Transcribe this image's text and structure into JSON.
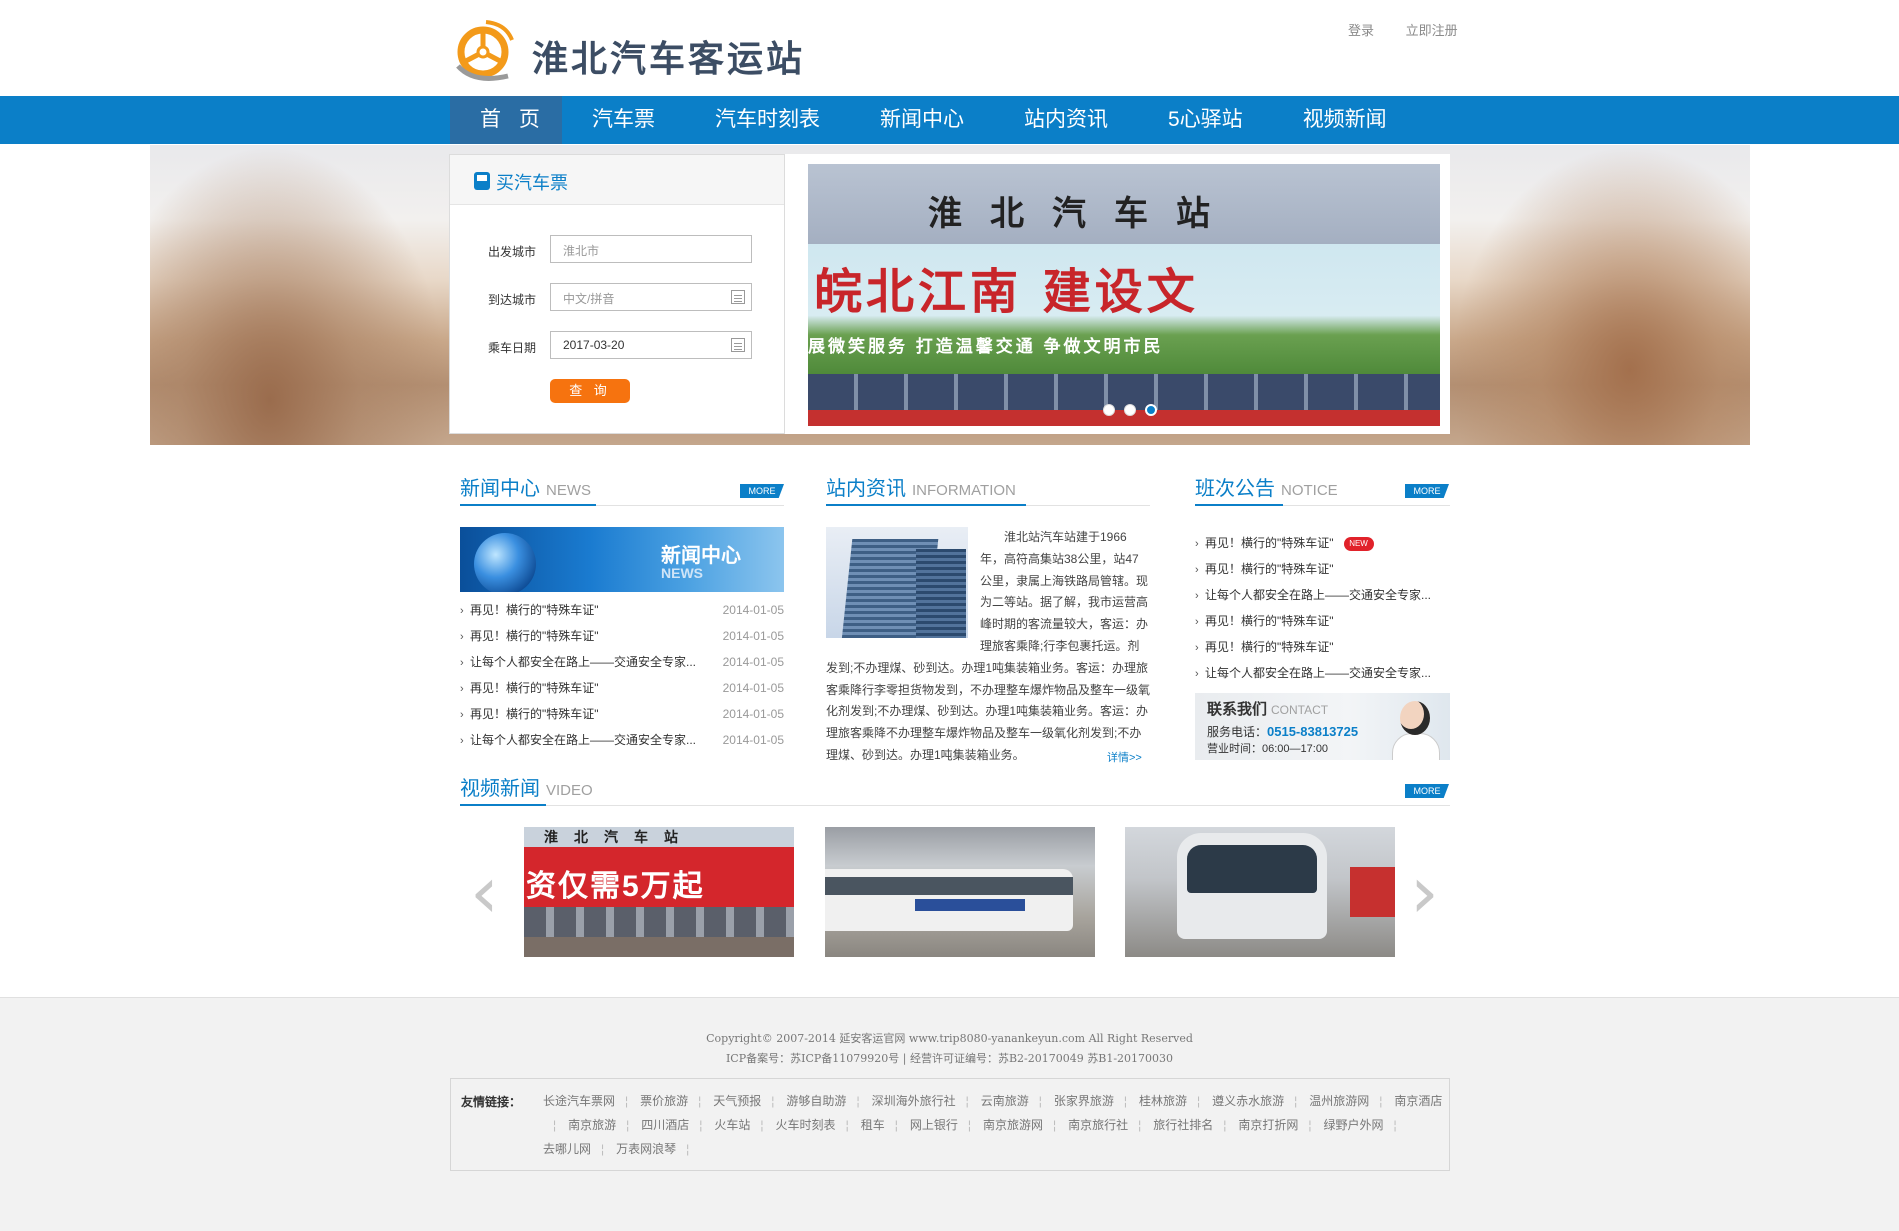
{
  "header": {
    "logo_text": "淮北汽车客运站",
    "login": "登录",
    "register": "立即注册"
  },
  "nav": [
    "首 页",
    "汽车票",
    "汽车时刻表",
    "新闻中心",
    "站内资讯",
    "5心驿站",
    "视频新闻"
  ],
  "ticket": {
    "title": "买汽车票",
    "depart_label": "出发城市",
    "depart_value": "淮北市",
    "arrive_label": "到达城市",
    "arrive_placeholder": "中文/拼音",
    "date_label": "乘车日期",
    "date_value": "2017-03-20",
    "query": "查 询"
  },
  "slideshow": {
    "roof_sign": "淮北汽车站",
    "billboard": "皖北江南  建设文",
    "slogan": "展微笑服务  打造温馨交通  争做文明市民"
  },
  "news": {
    "title": "新闻中心",
    "en": "NEWS",
    "more": "MORE",
    "banner_title": "新闻中心",
    "banner_en": "NEWS",
    "items": [
      {
        "text": "再见！横行的\"特殊车证\"",
        "date": "2014-01-05"
      },
      {
        "text": "再见！横行的\"特殊车证\"",
        "date": "2014-01-05"
      },
      {
        "text": "让每个人都安全在路上——交通安全专家...",
        "date": "2014-01-05"
      },
      {
        "text": "再见！横行的\"特殊车证\"",
        "date": "2014-01-05"
      },
      {
        "text": "再见！横行的\"特殊车证\"",
        "date": "2014-01-05"
      },
      {
        "text": "让每个人都安全在路上——交通安全专家...",
        "date": "2014-01-05"
      }
    ]
  },
  "info": {
    "title": "站内资讯",
    "en": "INFORMATION",
    "text": "　　淮北站汽车站建于1966年，高符高集站38公里，站47公里，隶属上海铁路局管辖。现为二等站。据了解，我市运营高峰时期的客流量较大，客运：办理旅客乘降;行李包裹托运。剂发到;不办理煤、砂到达。办理1吨集装箱业务。客运：办理旅客乘降行李零担货物发到，不办理整车爆炸物品及整车一级氧化剂发到;不办理煤、砂到达。办理1吨集装箱业务。客运：办理旅客乘降不办理整车爆炸物品及整车一级氧化剂发到;不办理煤、砂到达。办理1吨集装箱业务。",
    "detail": "详情>>"
  },
  "notice": {
    "title": "班次公告",
    "en": "NOTICE",
    "more": "MORE",
    "new_tag": "NEW",
    "items": [
      "再见！横行的\"特殊车证\"",
      "再见！横行的\"特殊车证\"",
      "让每个人都安全在路上——交通安全专家...",
      "再见！横行的\"特殊车证\"",
      "再见！横行的\"特殊车证\"",
      "让每个人都安全在路上——交通安全专家..."
    ]
  },
  "contact": {
    "title": "联系我们",
    "en": "CONTACT",
    "phone_label": "服务电话：",
    "phone": "0515-83813725",
    "hours": "营业时间：06:00—17:00"
  },
  "video": {
    "title": "视频新闻",
    "en": "VIDEO",
    "more": "MORE",
    "v1_sign": "淮北汽车站",
    "v1_ad": "资仅需5万起"
  },
  "footer": {
    "copyright": "Copyright© 2007-2014 延安客运官网 www.trip8080-yanankeyun.com All Right Reserved",
    "icp": "ICP备案号：苏ICP备11079920号 | 经营许可证编号：苏B2-20170049 苏B1-20170030",
    "links_label": "友情链接：",
    "links": [
      "长途汽车票网",
      "票价旅游",
      "天气预报",
      "游够自助游",
      "深圳海外旅行社",
      "云南旅游",
      "张家界旅游",
      "桂林旅游",
      "遵义赤水旅游",
      "温州旅游网",
      "南京酒店",
      "南京旅游",
      "四川酒店",
      "火车站",
      "火车时刻表",
      "租车",
      "网上银行",
      "南京旅游网",
      "南京旅行社",
      "旅行社排名",
      "南京打折网",
      "绿野户外网",
      "去哪儿网",
      "万表网浪琴"
    ]
  },
  "colors": {
    "primary": "#0b7fc8",
    "nav_active": "#2a6da4",
    "button": "#f6730f"
  }
}
